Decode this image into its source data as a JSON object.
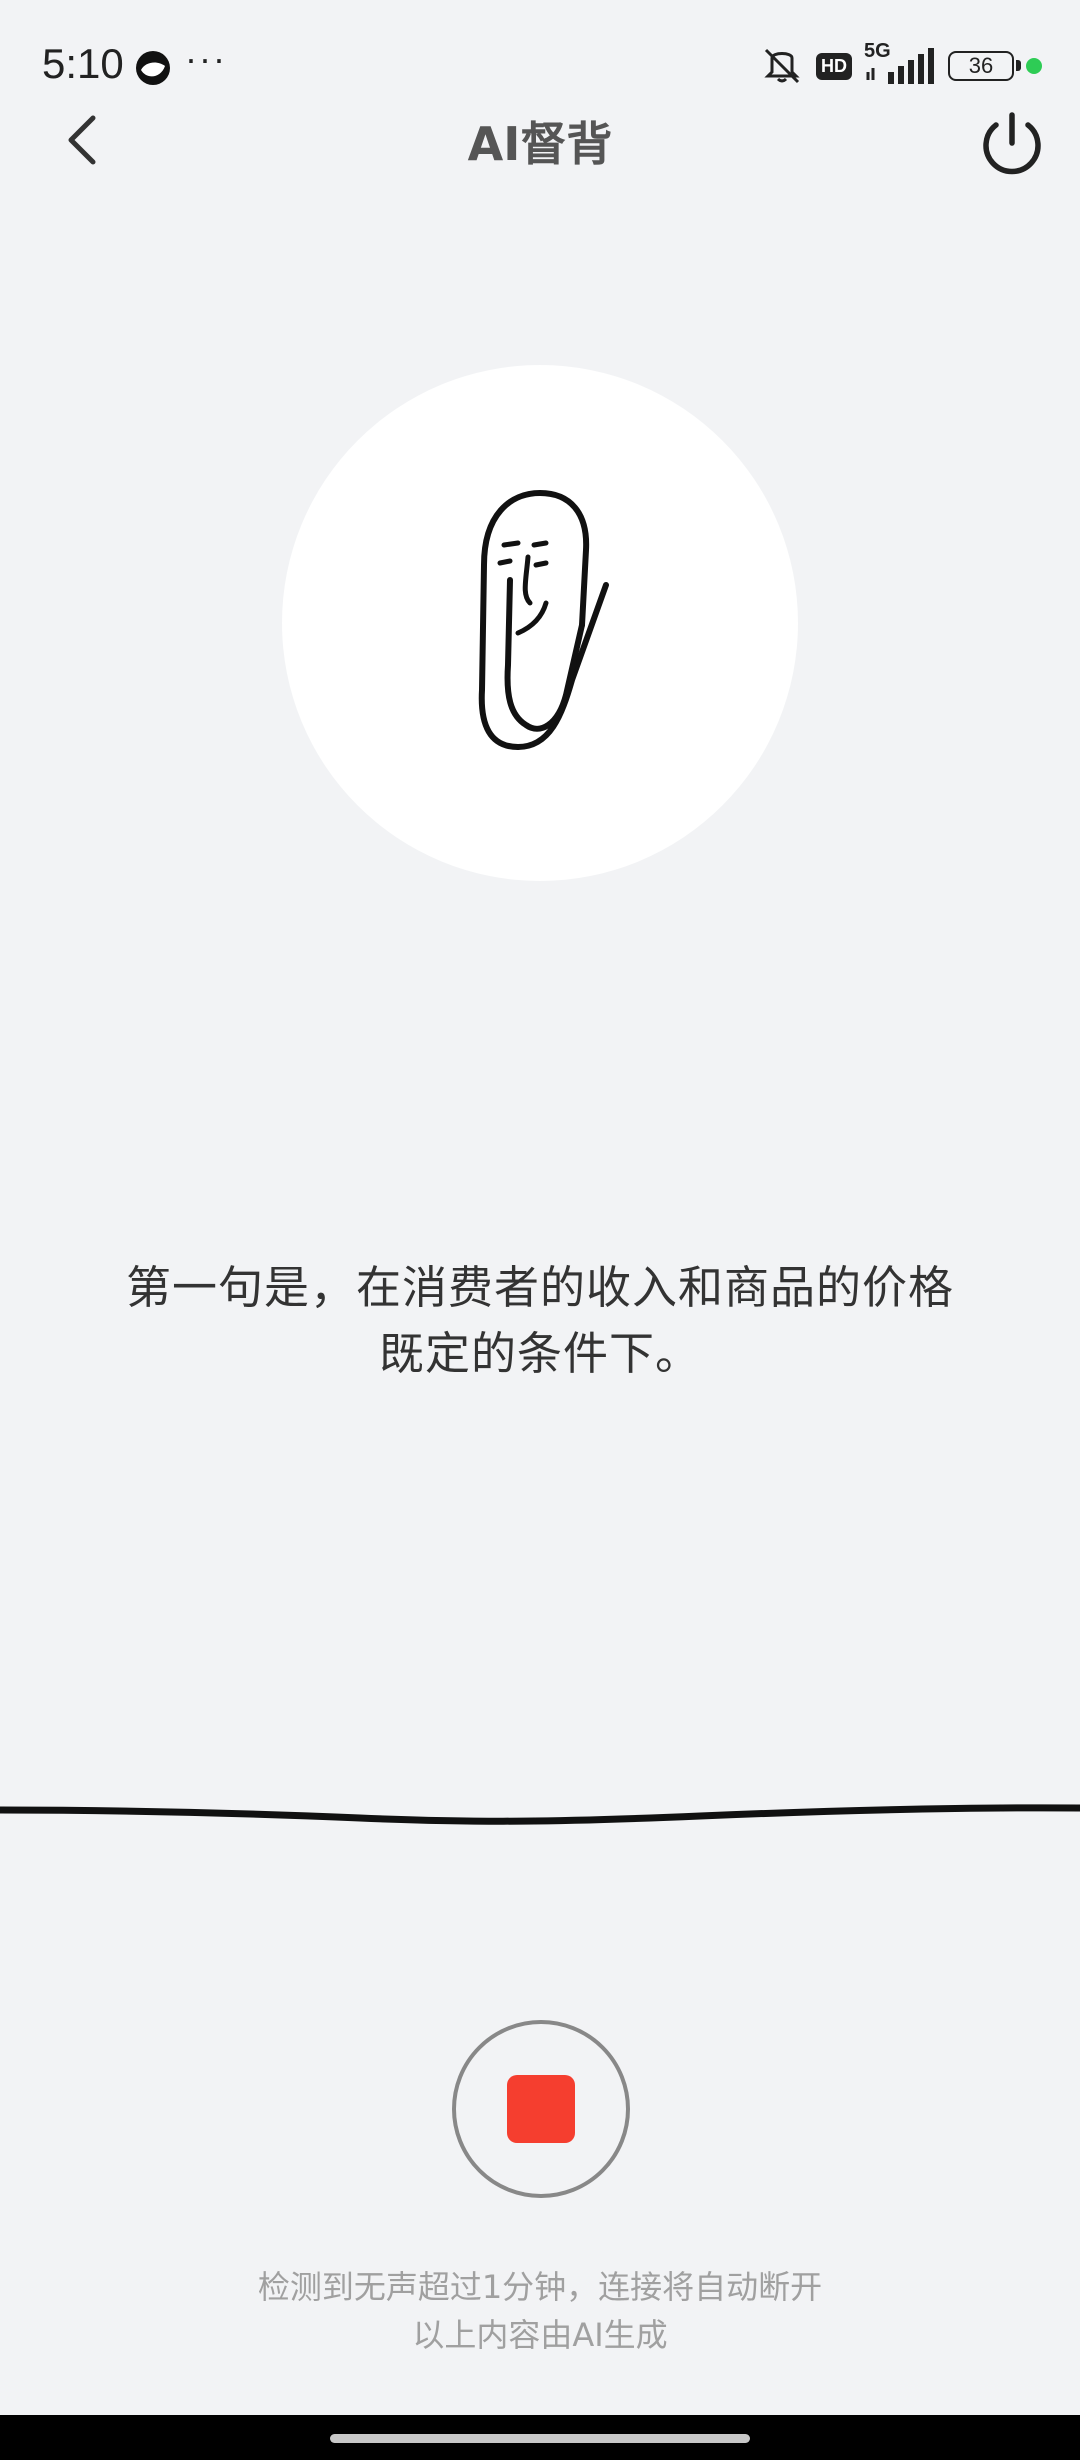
{
  "status_bar": {
    "time": "5:10",
    "more": "···",
    "hd": "HD",
    "network": "5G",
    "battery": "36",
    "dot_color": "#2ecc55"
  },
  "header": {
    "title": "AI督背",
    "back_icon": "chevron-left-icon",
    "power_icon": "power-icon"
  },
  "avatar": {
    "icon": "paperclip-face-icon"
  },
  "transcript": {
    "text": "第一句是，在消费者的收入和商品的价格既定的条件下。"
  },
  "controls": {
    "stop_icon": "stop-icon",
    "stop_color": "#f53e2f"
  },
  "footer": {
    "notice_line1": "检测到无声超过1分钟，连接将自动断开",
    "notice_line2": "以上内容由AI生成"
  }
}
